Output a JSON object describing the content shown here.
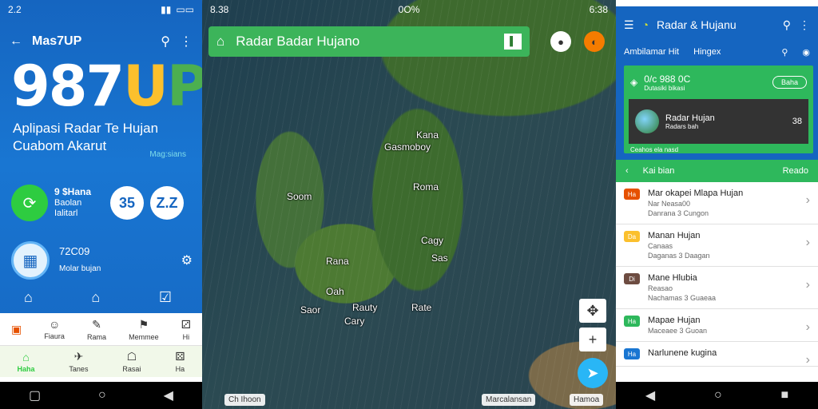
{
  "screen1": {
    "status": {
      "time": "2.2",
      "battery": "▭▭"
    },
    "title": "Mas7UP",
    "hero": {
      "digits": "987",
      "u": "U",
      "p": "P"
    },
    "tagline": "Aplipasi Radar Te Hujan Cuabom Akarut",
    "small_link": "Mag:sians",
    "card": {
      "name": "9 $Hana",
      "line2": "Baolan",
      "line3": "Ialitarl",
      "num1": "35",
      "num2": "Z.Z"
    },
    "row2": {
      "value": "72C09",
      "label": "Molar bujan"
    },
    "bottom_row1": [
      "Fiaura",
      "Rama",
      "Memmee",
      "Hi"
    ],
    "bottom_row2": [
      "Haha",
      "Tanes",
      "Rasai",
      "Ha"
    ]
  },
  "screen2": {
    "status": {
      "time": "8.38",
      "right": "6:38",
      "percent": "0O%"
    },
    "search_label": "Radar Badar Hujano",
    "places": [
      "Kana",
      "Gasmoboy",
      "Soom",
      "Roma",
      "Cagy",
      "Sas",
      "Rana",
      "Oah",
      "Saor",
      "Rauty",
      "Rate",
      "Cary"
    ],
    "footer_left": "Ch Ihoon",
    "footer_right1": "Marcalansan",
    "footer_right2": "Hamoa"
  },
  "screen3": {
    "app_title": "Radar & Hujanu",
    "sub_left": "Ambilamar Hit",
    "sub_right": "Hingex",
    "card_top": "0/c 988 0C",
    "card_top_sub": "Dutasiki bikasi",
    "card_btn": "Baha",
    "dark_title": "Radar Hujan",
    "dark_sub": "Radars bah",
    "dark_num": "38",
    "card_foot": "Ceahos ela nasd",
    "bar_left": "Kai bian",
    "bar_right": "Reado",
    "list": [
      {
        "badge": "Ha",
        "title": "Mar okapei Mlapa Hujan",
        "sub1": "Nar Neasa00",
        "sub2": "Danrana 3 Cungon"
      },
      {
        "badge": "Da",
        "title": "Manan Hujan",
        "sub1": "Canaas",
        "sub2": "Daganas 3 Daagan"
      },
      {
        "badge": "Di",
        "title": "Mane Hlubia",
        "sub1": "Reasao",
        "sub2": "Nachamas 3 Guaeaa"
      },
      {
        "badge": "Ha",
        "title": "Mapae Hujan",
        "sub1": "",
        "sub2": "Maceaee 3 Guoan"
      },
      {
        "badge": "Ha",
        "title": "Narlunene kugina",
        "sub1": "",
        "sub2": ""
      }
    ]
  }
}
